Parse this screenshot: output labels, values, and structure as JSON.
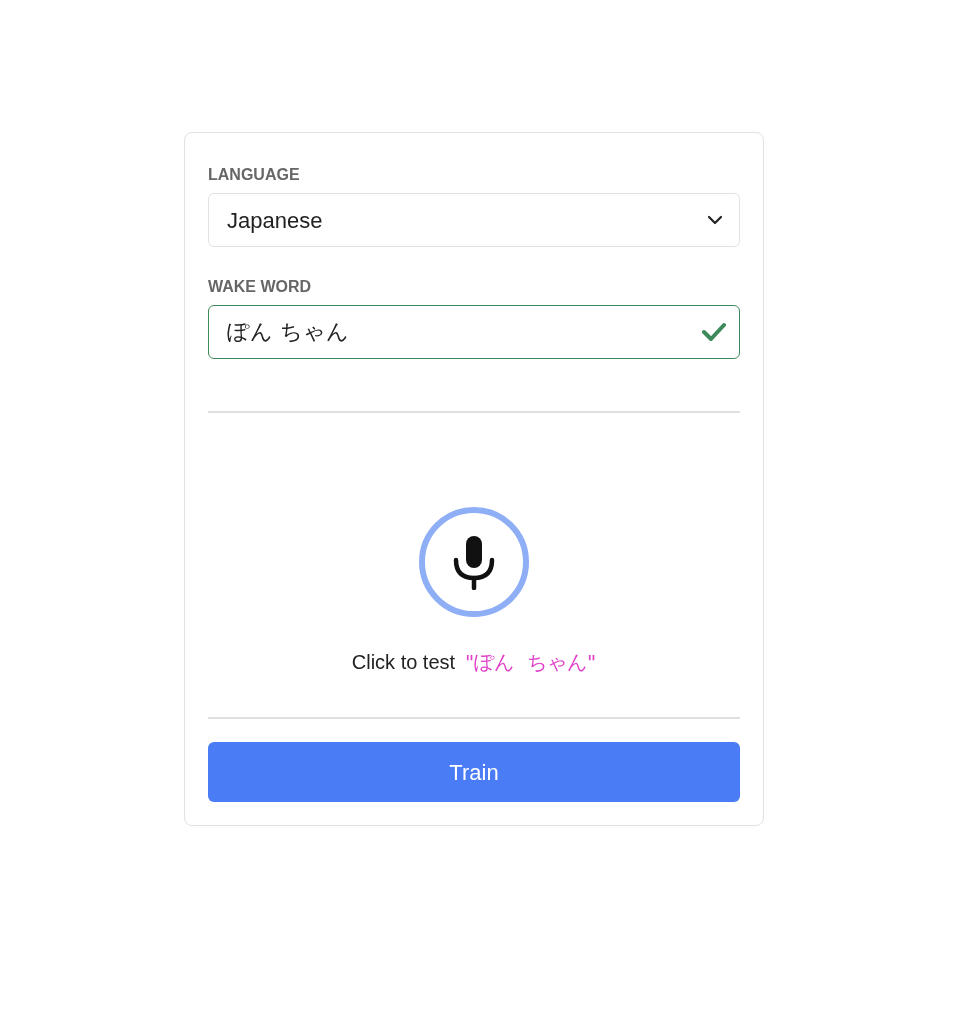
{
  "language": {
    "label": "LANGUAGE",
    "value": "Japanese"
  },
  "wake_word": {
    "label": "WAKE WORD",
    "value": "ぽん ちゃん",
    "valid": true
  },
  "test": {
    "prompt": "Click to test",
    "phrase": "\"ぽん  ちゃん\""
  },
  "train_button": {
    "label": "Train"
  }
}
